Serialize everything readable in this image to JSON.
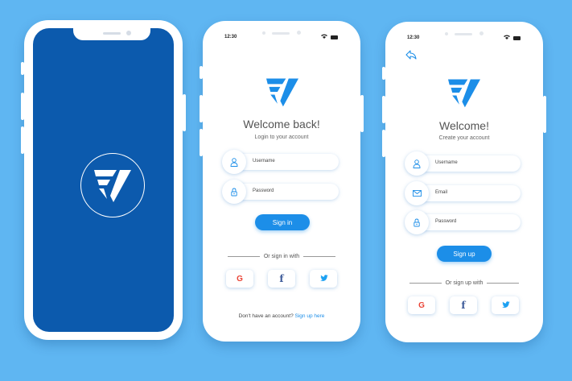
{
  "colors": {
    "background": "#5fb6f2",
    "brand": "#1c8ee8",
    "splash": "#0c5aad"
  },
  "splash": {
    "logo_icon": "fv-logo-icon"
  },
  "login": {
    "status_time": "12:30",
    "title": "Welcome back!",
    "subtitle": "Login to your account",
    "username_placeholder": "Username",
    "password_placeholder": "Password",
    "sign_in_label": "Sign in",
    "divider_text": "Or sign in with",
    "social": [
      "G",
      "f",
      "twitter-icon"
    ],
    "footer_text": "Don't have an account?",
    "footer_link": "Sign up here"
  },
  "signup": {
    "status_time": "12:30",
    "title": "Welcome!",
    "subtitle": "Create your account",
    "username_placeholder": "Username",
    "email_placeholder": "Email",
    "password_placeholder": "Password",
    "sign_up_label": "Sign up",
    "divider_text": "Or sign up with",
    "social": [
      "G",
      "f",
      "twitter-icon"
    ]
  }
}
